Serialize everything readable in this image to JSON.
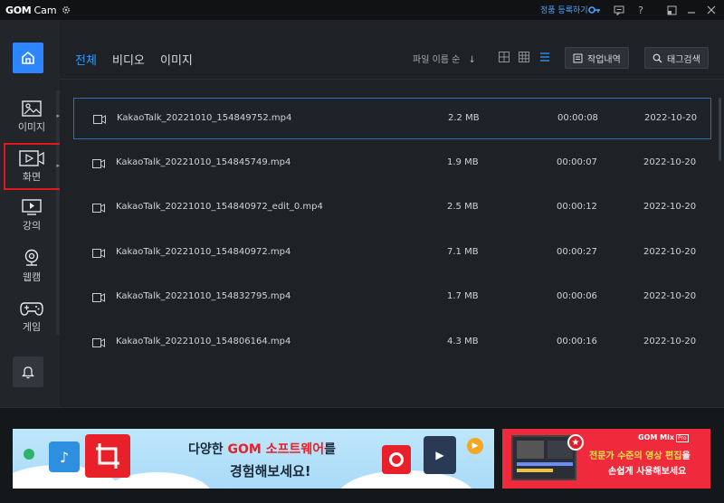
{
  "app": {
    "logo_gom": "GOM",
    "logo_cam": "Cam",
    "register_label": "정품 등록하기"
  },
  "sidebar": {
    "items": [
      {
        "id": "image",
        "label": "이미지",
        "icon": "image-icon"
      },
      {
        "id": "screen",
        "label": "화면",
        "icon": "screen-record-icon"
      },
      {
        "id": "lecture",
        "label": "강의",
        "icon": "lecture-icon"
      },
      {
        "id": "webcam",
        "label": "웹캠",
        "icon": "webcam-icon"
      },
      {
        "id": "game",
        "label": "게임",
        "icon": "gamepad-icon"
      }
    ]
  },
  "toolbar": {
    "tabs": [
      {
        "label": "전체",
        "active": true
      },
      {
        "label": "비디오",
        "active": false
      },
      {
        "label": "이미지",
        "active": false
      }
    ],
    "sort_label": "파일 이름 순",
    "sort_arrow": "↓",
    "history_button": "작업내역",
    "tag_search_button": "태그검색"
  },
  "files": [
    {
      "name": "KakaoTalk_20221010_154849752.mp4",
      "size": "2.2 MB",
      "duration": "00:00:08",
      "date": "2022-10-20",
      "selected": true
    },
    {
      "name": "KakaoTalk_20221010_154845749.mp4",
      "size": "1.9 MB",
      "duration": "00:00:07",
      "date": "2022-10-20",
      "selected": false
    },
    {
      "name": "KakaoTalk_20221010_154840972_edit_0.mp4",
      "size": "2.5 MB",
      "duration": "00:00:12",
      "date": "2022-10-20",
      "selected": false
    },
    {
      "name": "KakaoTalk_20221010_154840972.mp4",
      "size": "7.1 MB",
      "duration": "00:00:27",
      "date": "2022-10-20",
      "selected": false
    },
    {
      "name": "KakaoTalk_20221010_154832795.mp4",
      "size": "1.7 MB",
      "duration": "00:00:06",
      "date": "2022-10-20",
      "selected": false
    },
    {
      "name": "KakaoTalk_20221010_154806164.mp4",
      "size": "4.3 MB",
      "duration": "00:00:16",
      "date": "2022-10-20",
      "selected": false
    }
  ],
  "ads": {
    "left": {
      "line1_pre": "다양한 ",
      "line1_highlight": "GOM 소프트웨어",
      "line1_post": "를",
      "line2": "경험해보세요!"
    },
    "right": {
      "brand": "GOM Mix",
      "brand_badge": "Pro",
      "line1_highlight": "전문가 수준의 영상 편집",
      "line1_post": "을",
      "line2": "손쉽게 사용해보세요"
    }
  },
  "colors": {
    "accent": "#2d86ff",
    "selection_outline": "#e3161b",
    "ad_right_bg": "#ee2a3c"
  }
}
